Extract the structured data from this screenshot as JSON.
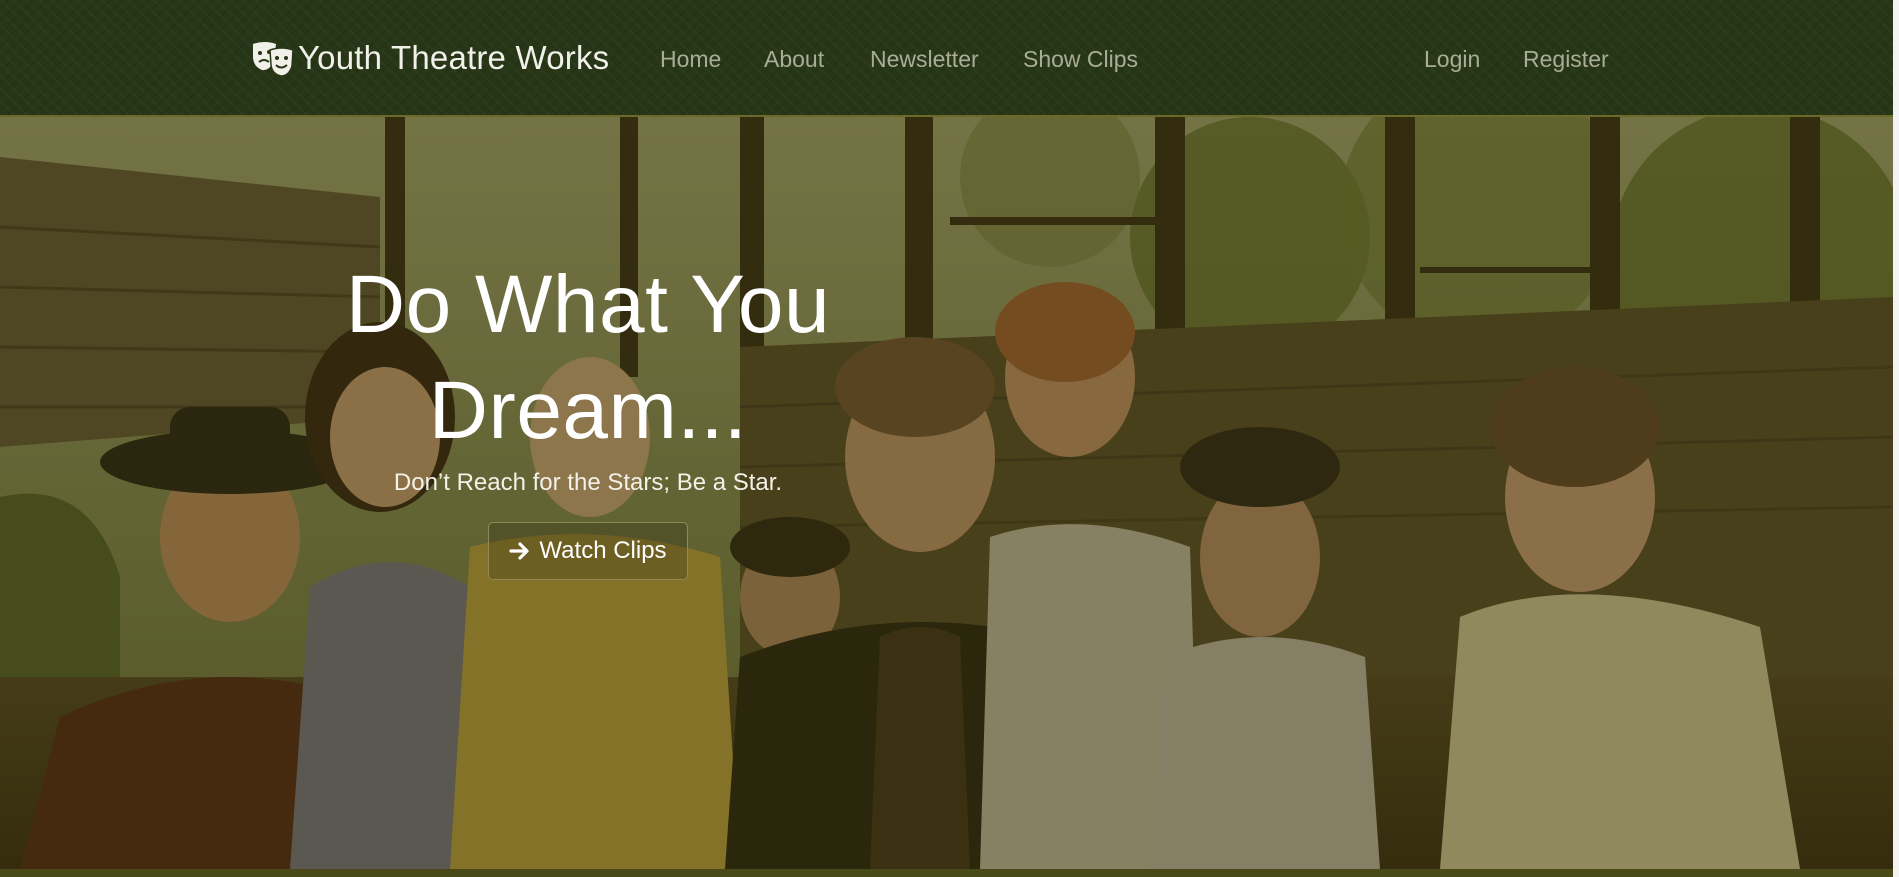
{
  "navbar": {
    "brand": "Youth Theatre Works",
    "brand_icon": "theatre-masks-icon",
    "links": [
      {
        "label": "Home"
      },
      {
        "label": "About"
      },
      {
        "label": "Newsletter"
      },
      {
        "label": "Show Clips"
      }
    ],
    "auth": {
      "login": "Login",
      "register": "Register"
    }
  },
  "hero": {
    "title_line1": "Do What You",
    "title_line2": "Dream...",
    "subtitle": "Don’t Reach for the Stars; Be a Star.",
    "cta_label": "Watch Clips",
    "cta_icon": "arrow-right-icon"
  },
  "colors": {
    "navbar_bg": "#263617",
    "overlay": "#403a0a",
    "text_light": "#ffffff",
    "nav_muted": "#a9ad95"
  }
}
